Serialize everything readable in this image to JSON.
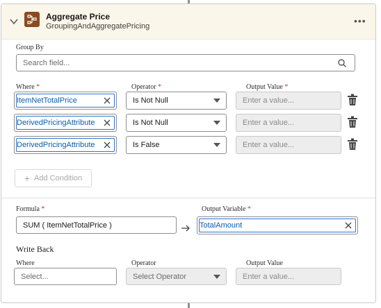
{
  "header": {
    "title": "Aggregate Price",
    "subtitle": "GroupingAndAggregatePricing",
    "more_label": "•••"
  },
  "group_by": {
    "label": "Group By",
    "search_placeholder": "Search field..."
  },
  "conditions": {
    "where_label": "Where",
    "operator_label": "Operator",
    "output_label": "Output Value",
    "required_mark": "*",
    "rows": [
      {
        "field": "ItemNetTotalPrice",
        "operator": "Is Not Null",
        "value_placeholder": "Enter a value..."
      },
      {
        "field": "DerivedPricingAttribute",
        "operator": "Is Not Null",
        "value_placeholder": "Enter a value..."
      },
      {
        "field": "DerivedPricingAttribute",
        "operator": "Is False",
        "value_placeholder": "Enter a value..."
      }
    ],
    "add_condition_label": "Add Condition",
    "add_icon": "+"
  },
  "formula": {
    "label": "Formula",
    "value": "SUM ( ItemNetTotalPrice )",
    "output_variable_label": "Output Variable",
    "output_variable_value": "TotalAmount"
  },
  "write_back": {
    "title": "Write Back",
    "where_label": "Where",
    "where_placeholder": "Select...",
    "operator_label": "Operator",
    "operator_placeholder": "Select Operator",
    "output_label": "Output Value",
    "output_placeholder": "Enter a value..."
  },
  "colors": {
    "header_bg": "#fbf6ea",
    "icon_bg": "#8a4b20",
    "pill_border": "#2f74d0",
    "pill_text": "#0b5cab",
    "required": "#c23934"
  }
}
